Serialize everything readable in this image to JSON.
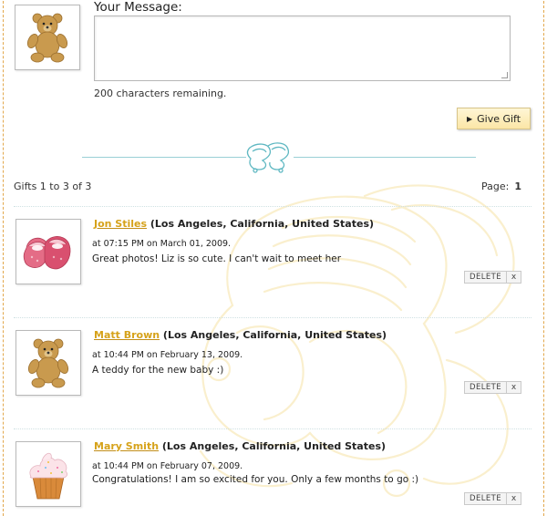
{
  "compose": {
    "label": "Your Message:",
    "textarea_value": "",
    "chars_remaining": "200 characters remaining.",
    "give_button": "Give Gift"
  },
  "listing": {
    "count_text": "Gifts 1 to 3 of 3",
    "page_label": "Page:",
    "page_number": "1"
  },
  "gifts": [
    {
      "name": "Jon Stiles",
      "location": "(Los Angeles, California, United States)",
      "time": "at 07:15 PM on March 01, 2009.",
      "message": "Great photos! Liz is so cute. I can't wait to meet her",
      "icon": "baby-booties-icon",
      "delete_label": "DELETE",
      "close_label": "x"
    },
    {
      "name": "Matt Brown",
      "location": "(Los Angeles, California, United States)",
      "time": "at 10:44 PM on February 13, 2009.",
      "message": "A teddy for the new baby :)",
      "icon": "teddy-bear-icon",
      "delete_label": "DELETE",
      "close_label": "x"
    },
    {
      "name": "Mary Smith",
      "location": "(Los Angeles, California, United States)",
      "time": "at 10:44 PM on February 07, 2009.",
      "message": "Congratulations! I am so excited for you. Only a few months to go :)",
      "icon": "cupcake-icon",
      "delete_label": "DELETE",
      "close_label": "x"
    }
  ],
  "colors": {
    "link": "#d6a21a",
    "frame_border": "#e2a74b",
    "button_bg": "#fbe6a6",
    "divider": "#9ad0d6"
  }
}
